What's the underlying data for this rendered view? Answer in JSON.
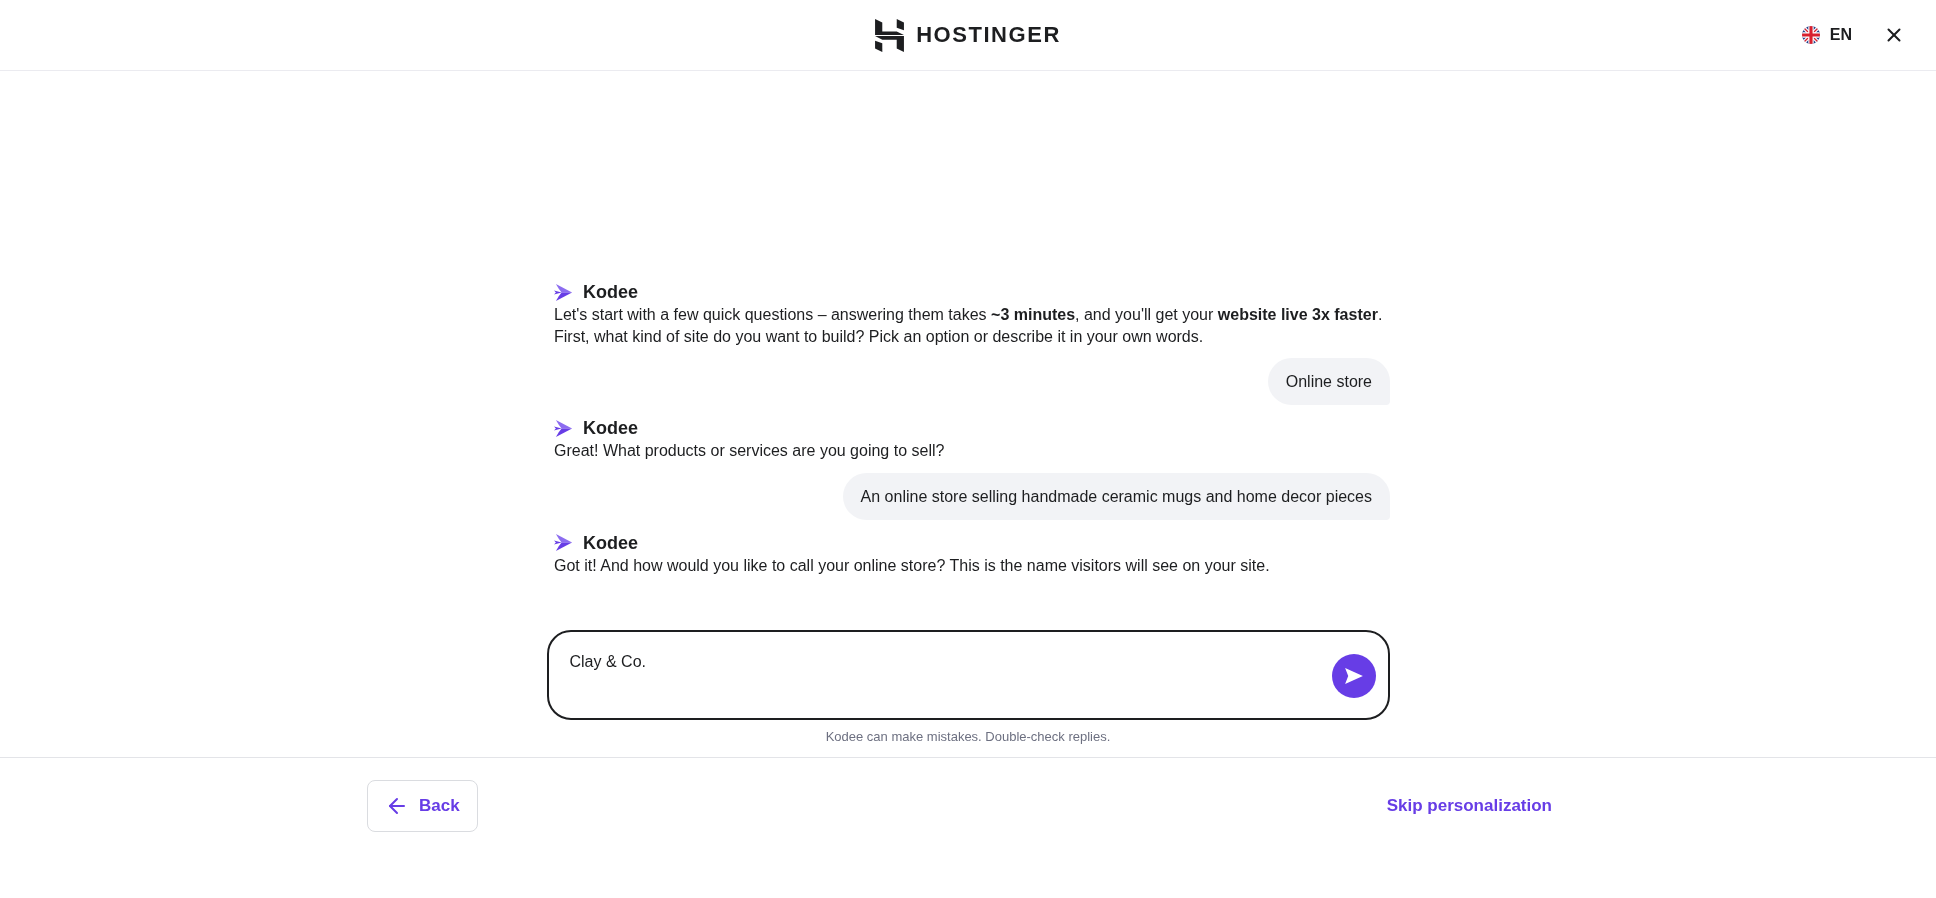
{
  "header": {
    "logo_text": "HOSTINGER",
    "language": "EN"
  },
  "chat": {
    "messages": [
      {
        "kind": "assistant",
        "sender": "Kodee",
        "lines": [
          "Let's start with a few quick questions – answering them takes **~3 minutes**, and you'll get your **website live 3x faster**.",
          "First, what kind of site do you want to build? Pick an option or describe it in your own words."
        ]
      },
      {
        "kind": "user",
        "text": "Online store"
      },
      {
        "kind": "assistant",
        "sender": "Kodee",
        "lines": [
          "Great! What products or services are you going to sell?"
        ]
      },
      {
        "kind": "user",
        "text": "An online store selling handmade ceramic mugs and home decor pieces"
      },
      {
        "kind": "assistant",
        "sender": "Kodee",
        "lines": [
          "Got it! And how would you like to call your online store? This is the name visitors will see on your site."
        ]
      }
    ]
  },
  "input": {
    "value": "Clay & Co."
  },
  "disclaimer": "Kodee can make mistakes. Double-check replies.",
  "footer": {
    "back_button": "Back",
    "skip_link": "Skip personalization"
  }
}
